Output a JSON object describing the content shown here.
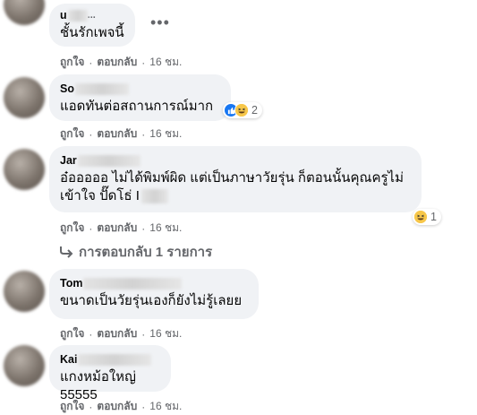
{
  "comments": [
    {
      "name": "u",
      "name_tail": "...",
      "text": "ชั้นรักเพจนี้",
      "like_label": "ถูกใจ",
      "reply_label": "ตอบกลับ",
      "time": "16 ชม."
    },
    {
      "name": "So",
      "text": "แอดทันต่อสถานการณ์มาก",
      "like_label": "ถูกใจ",
      "reply_label": "ตอบกลับ",
      "time": "16 ชม.",
      "reaction_count": "2"
    },
    {
      "name": "Jar",
      "text_line1": "อ๋อออออ ไม่ได้พิมพ์ผิด แต่เป็นภาษาวัยรุ่น ก็ตอนนั้นคุณครูไม่",
      "text_line2": "เข้าใจ ปั๊ดโธ่ I",
      "like_label": "ถูกใจ",
      "reply_label": "ตอบกลับ",
      "time": "16 ชม.",
      "reaction_count": "1"
    },
    {
      "name": "Tom",
      "text": "ขนาดเป็นวัยรุ่นเองก็ยังไม่รู้เลยย",
      "like_label": "ถูกใจ",
      "reply_label": "ตอบกลับ",
      "time": "16 ชม."
    },
    {
      "name": "Kai",
      "text": "แกงหม้อใหญ่ 55555",
      "like_label": "ถูกใจ",
      "reply_label": "ตอบกลับ",
      "time": "16 ชม."
    }
  ],
  "replies_link": "การตอบกลับ 1 รายการ",
  "more_label": "•••",
  "dot": "·",
  "icons": {
    "like": "like-icon",
    "haha": "haha-icon",
    "reply_arrow": "reply-arrow-icon",
    "more": "more-icon"
  }
}
